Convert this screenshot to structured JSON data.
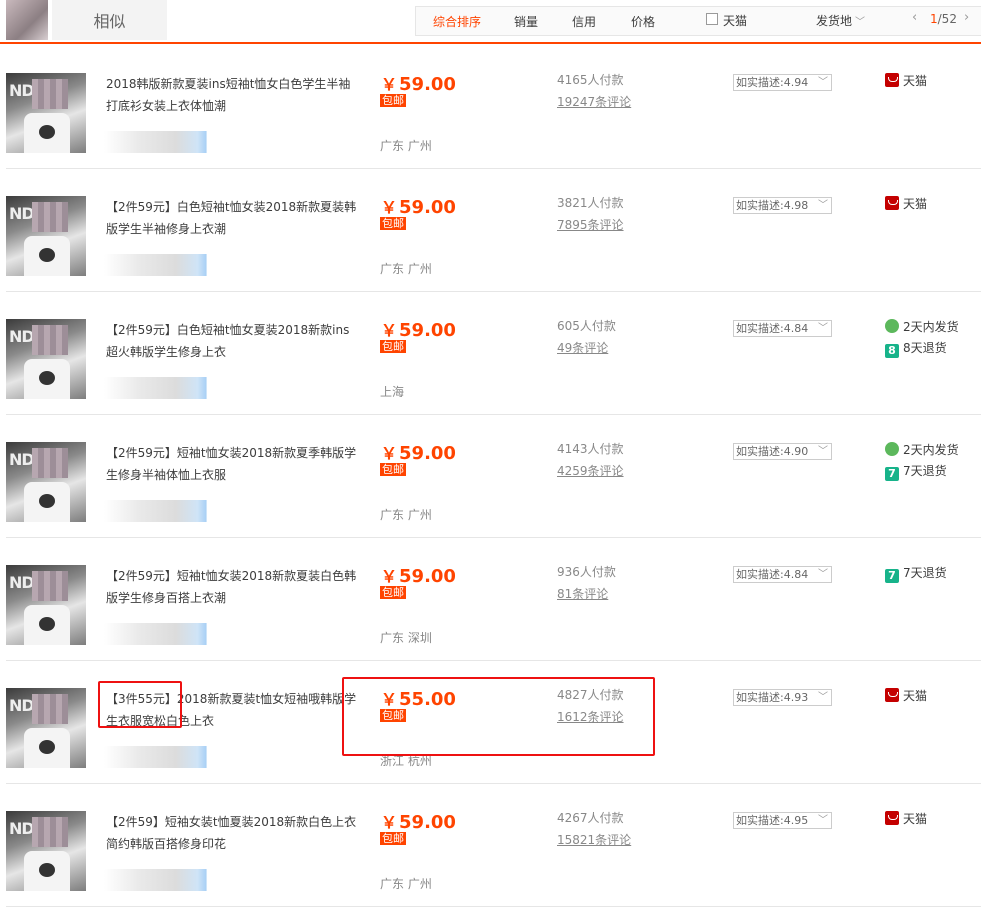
{
  "topbar": {
    "similar_tab": "相似",
    "sort_items": [
      {
        "label": "综合排序",
        "active": true
      },
      {
        "label": "销量",
        "active": false
      },
      {
        "label": "信用",
        "active": false
      },
      {
        "label": "价格",
        "active": false
      }
    ],
    "tmall_filter": "天猫",
    "ship_from": "发货地",
    "page_current": "1",
    "page_total": "/52",
    "accent_color": "#ff4400"
  },
  "products": [
    {
      "title": "2018韩版新款夏装ins短袖t恤女白色学生半袖打底衫女装上衣体恤潮",
      "price": "59.00",
      "free_shipping": "包邮",
      "location": "广东 广州",
      "sales": "4165人付款",
      "comments": "19247条评论",
      "rating": "如实描述:4.94",
      "badges": [
        {
          "type": "tmall",
          "label": "天猫"
        }
      ]
    },
    {
      "title": "【2件59元】白色短袖t恤女装2018新款夏装韩版学生半袖修身上衣潮",
      "price": "59.00",
      "free_shipping": "包邮",
      "location": "广东 广州",
      "sales": "3821人付款",
      "comments": "7895条评论",
      "rating": "如实描述:4.98",
      "badges": [
        {
          "type": "tmall",
          "label": "天猫"
        }
      ]
    },
    {
      "title": "【2件59元】白色短袖t恤女夏装2018新款ins超火韩版学生修身上衣",
      "price": "59.00",
      "free_shipping": "包邮",
      "location": "上海",
      "sales": "605人付款",
      "comments": "49条评论",
      "rating": "如实描述:4.84",
      "badges": [
        {
          "type": "ship2",
          "label": "2天内发货"
        },
        {
          "type": "ret8",
          "label": "8天退货"
        }
      ]
    },
    {
      "title": "【2件59元】短袖t恤女装2018新款夏季韩版学生修身半袖体恤上衣服",
      "price": "59.00",
      "free_shipping": "包邮",
      "location": "广东 广州",
      "sales": "4143人付款",
      "comments": "4259条评论",
      "rating": "如实描述:4.90",
      "badges": [
        {
          "type": "ship2",
          "label": "2天内发货"
        },
        {
          "type": "ret7",
          "label": "7天退货"
        }
      ]
    },
    {
      "title": "【2件59元】短袖t恤女装2018新款夏装白色韩版学生修身百搭上衣潮",
      "price": "59.00",
      "free_shipping": "包邮",
      "location": "广东 深圳",
      "sales": "936人付款",
      "comments": "81条评论",
      "rating": "如实描述:4.84",
      "badges": [
        {
          "type": "ret7",
          "label": "7天退货"
        }
      ]
    },
    {
      "title": "【3件55元】2018新款夏装t恤女短袖哦韩版学生衣服宽松白色上衣",
      "price": "55.00",
      "free_shipping": "包邮",
      "location": "浙江 杭州",
      "sales": "4827人付款",
      "comments": "1612条评论",
      "rating": "如实描述:4.93",
      "badges": [
        {
          "type": "tmall",
          "label": "天猫"
        }
      ]
    },
    {
      "title": "【2件59】短袖女装t恤夏装2018新款白色上衣简约韩版百搭修身印花",
      "price": "59.00",
      "free_shipping": "包邮",
      "location": "广东 广州",
      "sales": "4267人付款",
      "comments": "15821条评论",
      "rating": "如实描述:4.95",
      "badges": [
        {
          "type": "tmall",
          "label": "天猫"
        }
      ]
    }
  ],
  "currency_symbol": "￥"
}
